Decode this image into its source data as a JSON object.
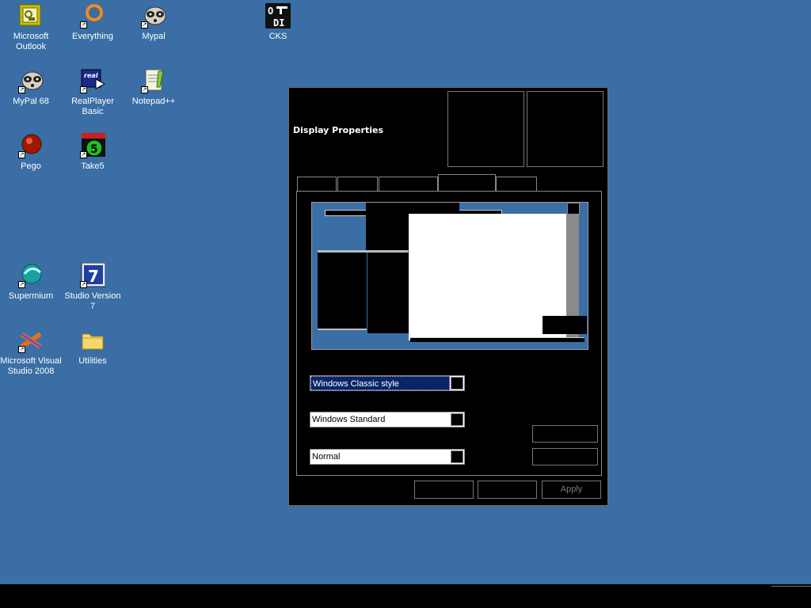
{
  "desktop": {
    "icons": [
      {
        "label": "Microsoft Outlook",
        "icon": "outlook-icon"
      },
      {
        "label": "Everything",
        "icon": "everything-icon"
      },
      {
        "label": "Mypal",
        "icon": "mypal-icon"
      },
      {
        "label": "CKS",
        "icon": "cks-icon"
      },
      {
        "label": "MyPal 68",
        "icon": "mypal68-icon"
      },
      {
        "label": "RealPlayer Basic",
        "icon": "realplayer-icon"
      },
      {
        "label": "Notepad++",
        "icon": "notepadpp-icon"
      },
      {
        "label": "Pego",
        "icon": "pego-icon"
      },
      {
        "label": "Take5",
        "icon": "take5-icon"
      },
      {
        "label": "Supermium",
        "icon": "supermium-icon"
      },
      {
        "label": "Studio Version 7",
        "icon": "studio7-icon"
      },
      {
        "label": "Microsoft Visual Studio 2008",
        "icon": "visual-studio-icon"
      },
      {
        "label": "Utilities",
        "icon": "folder-icon"
      }
    ],
    "background_color": "#3a6ea5"
  },
  "dialog": {
    "title": "Display Properties",
    "icon_glyphs": {
      "cks_top": "O",
      "cks_bottom": "DI",
      "real_text": "real",
      "take5_text": "5",
      "studio_text": "7"
    },
    "windows_buttons_style": "Windows Classic style",
    "color_scheme": "Windows Standard",
    "font_size": "Normal",
    "apply_label": "Apply"
  },
  "colors": {
    "selection": "#0a246a",
    "window_bg": "#000000"
  }
}
